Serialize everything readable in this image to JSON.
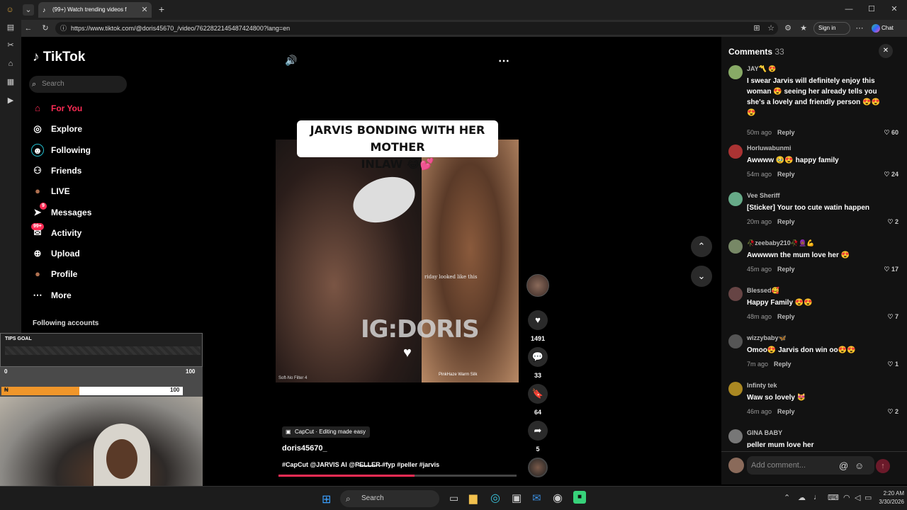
{
  "browser": {
    "tab_title": "(99+) Watch trending videos f",
    "url": "https://www.tiktok.com/@doris45670_/video/7622822145487424800?lang=en",
    "sign_in": "Sign in",
    "chat": "Chat"
  },
  "sidebar": {
    "logo": "TikTok",
    "search_placeholder": "Search",
    "items": [
      {
        "label": "For You",
        "icon": "home-icon"
      },
      {
        "label": "Explore",
        "icon": "compass-icon"
      },
      {
        "label": "Following",
        "icon": "following-icon"
      },
      {
        "label": "Friends",
        "icon": "friends-icon"
      },
      {
        "label": "LIVE",
        "icon": "live-icon"
      },
      {
        "label": "Messages",
        "icon": "send-icon",
        "badge": "9"
      },
      {
        "label": "Activity",
        "icon": "inbox-icon",
        "badge": "99+"
      },
      {
        "label": "Upload",
        "icon": "upload-icon"
      },
      {
        "label": "Profile",
        "icon": "avatar-icon"
      },
      {
        "label": "More",
        "icon": "more-icon"
      }
    ],
    "following_accounts": "Following accounts"
  },
  "video": {
    "caption_line1": "JARVIS BONDING WITH HER MOTHER",
    "caption_line2": "INLAW 😂💕",
    "watermark": "IG:DORIS",
    "overlay_text": "riday looked like this",
    "effect_left": "Soft-No Filter 4",
    "effect_right": "PinkHaze Warm Silk",
    "capcut": "CapCut · Editing made easy",
    "author": "doris45670_",
    "hashtags": "#CapCut @JARVIS AI @P̶E̶L̶L̶E̶R̶ #fyp #peller #jarvis",
    "likes": "1491",
    "comments": "33",
    "saves": "64",
    "shares": "5"
  },
  "comments": {
    "title": "Comments",
    "count": "33",
    "reply_label": "Reply",
    "add_placeholder": "Add comment...",
    "items": [
      {
        "name": "JAY〽️ 😍",
        "text": "I swear Jarvis will definitely enjoy this woman 😍 seeing her already tells you she's a lovely and friendly person 😍😍😍",
        "time": "50m ago",
        "likes": "60",
        "color": "#8a6"
      },
      {
        "name": "Horluwabunmi",
        "text": "Awwww 🥹😍 happy family",
        "time": "54m ago",
        "likes": "24",
        "color": "#a33"
      },
      {
        "name": "Vee Sheriff",
        "text": "[Sticker] Your too cute watin happen",
        "time": "20m ago",
        "likes": "2",
        "color": "#6a8"
      },
      {
        "name": "🥀zeebaby210🥀🧕🏾💪",
        "text": "Awwwwn the mum love her 😍",
        "time": "45m ago",
        "likes": "17",
        "color": "#786"
      },
      {
        "name": "Blessed🥰",
        "text": "Happy Family 😍😍",
        "time": "48m ago",
        "likes": "7",
        "color": "#644"
      },
      {
        "name": "wizzybaby🦋",
        "text": "Omoo😍 Jarvis don win oo😍😍",
        "time": "7m ago",
        "likes": "1",
        "color": "#555"
      },
      {
        "name": "Infinty tek",
        "text": "Waw so lovely 😻",
        "time": "46m ago",
        "likes": "2",
        "color": "#a82"
      },
      {
        "name": "GINA BABY",
        "text": "peller mum love her",
        "time": "",
        "likes": "",
        "color": "#777"
      }
    ]
  },
  "stream": {
    "tips_goal": "TIPS GOAL",
    "goal_max1": "100",
    "goal_min": "0",
    "goal_max2": "100",
    "goal_fill": 0.43
  },
  "taskbar": {
    "search": "Search",
    "time": "2:20 AM",
    "date": "3/30/2026"
  }
}
